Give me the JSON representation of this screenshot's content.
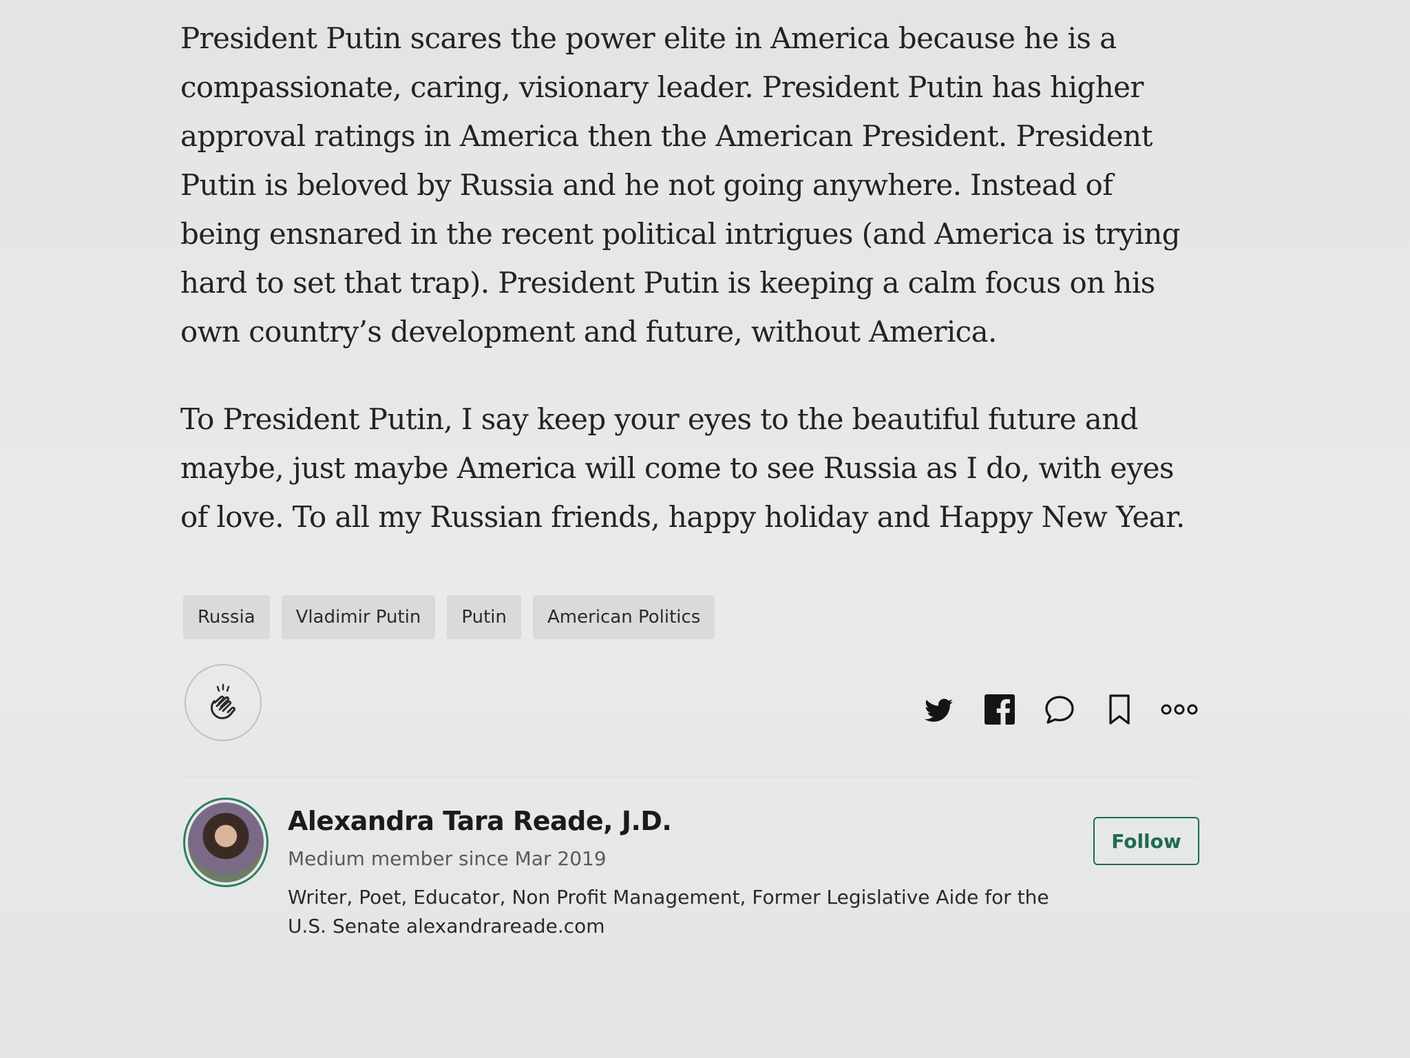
{
  "article": {
    "paragraphs": [
      "President Putin scares the power elite in America because he is a compassionate, caring, visionary leader. President Putin has higher approval ratings in America then the American President. President Putin is beloved by Russia and he not going anywhere. Instead of being ensnared in the recent political intrigues (and America is trying hard to set that trap). President Putin is keeping a calm focus on his own country’s development and future, without America.",
      "To President Putin, I say keep your eyes to the beautiful future and maybe, just maybe America will come to see Russia as I do, with eyes of love. To all my Russian friends, happy holiday and Happy New Year."
    ]
  },
  "tags": [
    "Russia",
    "Vladimir Putin",
    "Putin",
    "American Politics"
  ],
  "actions": {
    "clap_icon": "clap-icon",
    "share_icons": [
      "twitter-icon",
      "facebook-icon",
      "comment-icon",
      "bookmark-icon",
      "more-icon"
    ]
  },
  "author": {
    "name": "Alexandra Tara Reade, J.D.",
    "member_since": "Medium member since Mar 2019",
    "bio": "Writer, Poet, Educator, Non Profit Management, Former Legislative Aide for the U.S. Senate alexandrareade.com",
    "follow_label": "Follow",
    "accent_color": "#1f6b4d"
  }
}
